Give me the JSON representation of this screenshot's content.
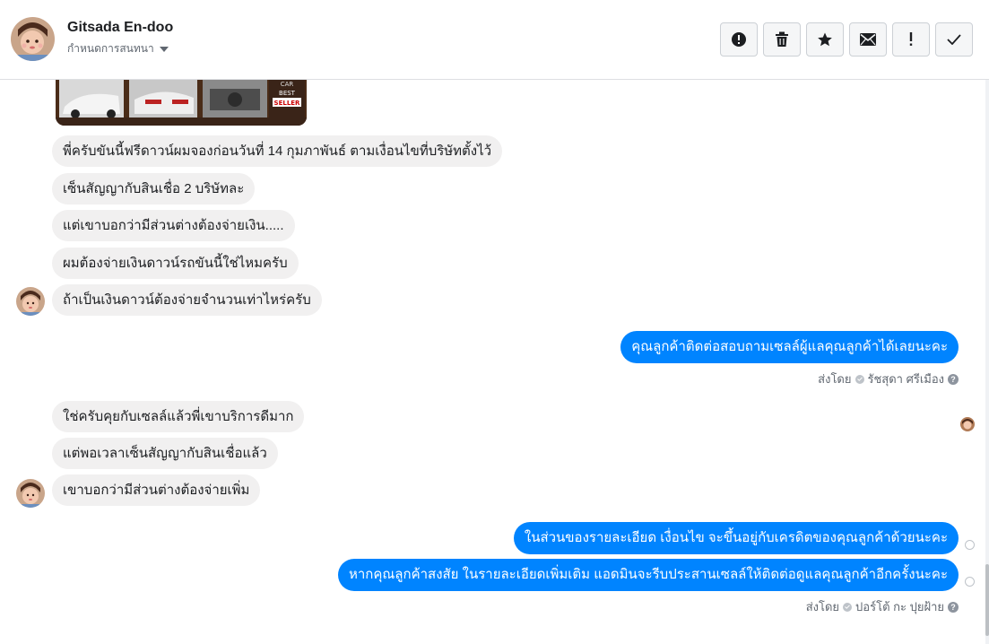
{
  "header": {
    "contact_name": "Gitsada En-doo",
    "assign_label": "กำหนดการสนทนา"
  },
  "actions": [
    {
      "icon": "alert-circle-icon",
      "label": "Mark as spam"
    },
    {
      "icon": "trash-icon",
      "label": "Delete"
    },
    {
      "icon": "star-icon",
      "label": "Star"
    },
    {
      "icon": "envelope-icon",
      "label": "Mark as unread"
    },
    {
      "icon": "exclamation-icon",
      "label": "Follow up"
    },
    {
      "icon": "check-icon",
      "label": "Mark as done"
    }
  ],
  "messages": {
    "in_1": "พี่ครับขันนี้ฟรีดาวน์ผมจองก่อนวันที่ 14 กุมภาพันธ์ ตามเงื่อนไขที่บริษัทตั้งไว้",
    "in_2": "เซ็นสัญญากับสินเชื่อ 2 บริษัทละ",
    "in_3": "แต่เขาบอกว่ามีส่วนต่างต้องจ่ายเงิน.....",
    "in_4": "ผมต้องจ่ายเงินดาวน์รถขันนี้ใช่ไหมครับ",
    "in_5": "ถ้าเป็นเงินดาวน์ต้องจ่ายจำนวนเท่าไหร่ครับ",
    "out_1": "คุณลูกค้าติดต่อสอบถามเซลล์ผู้แลคุณลูกค้าได้เลยนะคะ",
    "sent_by_1_label": "ส่งโดย",
    "sent_by_1_name": "รัชสุดา ศรีเมือง",
    "in_6": "ใช่ครับคุยกับเซลล์แล้วพี่เขาบริการดีมาก",
    "in_7": "แต่พอเวลาเซ็นสัญญากับสินเชื่อแล้ว",
    "in_8": "เขาบอกว่ามีส่วนต่างต้องจ่ายเพิ่ม",
    "out_2": "ในส่วนของรายละเอียด เงื่อนไข จะขึ้นอยู่กับเครดิตของคุณลูกค้าด้วยนะคะ",
    "out_3": "หากคุณลูกค้าสงสัย ในรายละเอียดเพิ่มเติม แอดมินจะรีบประสานเซลล์ให้ติดต่อดูแลคุณลูกค้าอีกครั้งนะคะ",
    "sent_by_2_label": "ส่งโดย",
    "sent_by_2_name": "ปอร์โต้ กะ ปุยฝ้าย"
  },
  "attachment": {
    "badge_top": "CAR",
    "badge_mid": "BEST",
    "badge_bot": "SELLER"
  },
  "colors": {
    "outgoing_bubble": "#0084ff",
    "incoming_bubble": "#f1f0f0"
  }
}
